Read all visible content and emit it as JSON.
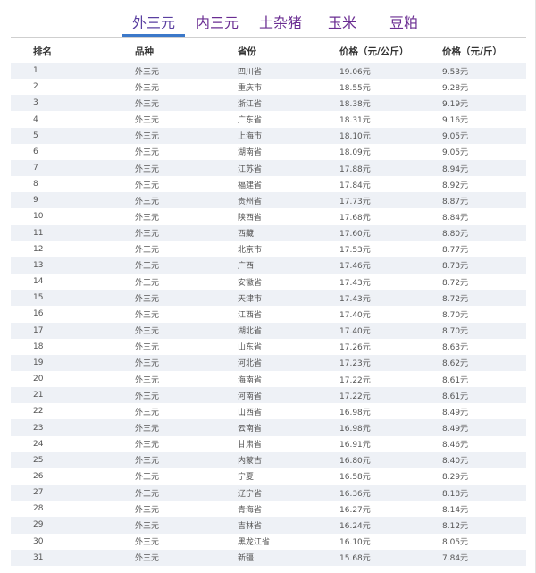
{
  "tabs": [
    {
      "label": "外三元",
      "active": true
    },
    {
      "label": "内三元",
      "active": false
    },
    {
      "label": "土杂猪",
      "active": false
    },
    {
      "label": "玉米",
      "active": false
    },
    {
      "label": "豆粕",
      "active": false
    }
  ],
  "table": {
    "headers": [
      "排名",
      "品种",
      "省份",
      "价格（元/公斤）",
      "价格（元/斤）"
    ],
    "rows": [
      [
        "1",
        "外三元",
        "四川省",
        "19.06元",
        "9.53元"
      ],
      [
        "2",
        "外三元",
        "重庆市",
        "18.55元",
        "9.28元"
      ],
      [
        "3",
        "外三元",
        "浙江省",
        "18.38元",
        "9.19元"
      ],
      [
        "4",
        "外三元",
        "广东省",
        "18.31元",
        "9.16元"
      ],
      [
        "5",
        "外三元",
        "上海市",
        "18.10元",
        "9.05元"
      ],
      [
        "6",
        "外三元",
        "湖南省",
        "18.09元",
        "9.05元"
      ],
      [
        "7",
        "外三元",
        "江苏省",
        "17.88元",
        "8.94元"
      ],
      [
        "8",
        "外三元",
        "福建省",
        "17.84元",
        "8.92元"
      ],
      [
        "9",
        "外三元",
        "贵州省",
        "17.73元",
        "8.87元"
      ],
      [
        "10",
        "外三元",
        "陕西省",
        "17.68元",
        "8.84元"
      ],
      [
        "11",
        "外三元",
        "西藏",
        "17.60元",
        "8.80元"
      ],
      [
        "12",
        "外三元",
        "北京市",
        "17.53元",
        "8.77元"
      ],
      [
        "13",
        "外三元",
        "广西",
        "17.46元",
        "8.73元"
      ],
      [
        "14",
        "外三元",
        "安徽省",
        "17.43元",
        "8.72元"
      ],
      [
        "15",
        "外三元",
        "天津市",
        "17.43元",
        "8.72元"
      ],
      [
        "16",
        "外三元",
        "江西省",
        "17.40元",
        "8.70元"
      ],
      [
        "17",
        "外三元",
        "湖北省",
        "17.40元",
        "8.70元"
      ],
      [
        "18",
        "外三元",
        "山东省",
        "17.26元",
        "8.63元"
      ],
      [
        "19",
        "外三元",
        "河北省",
        "17.23元",
        "8.62元"
      ],
      [
        "20",
        "外三元",
        "海南省",
        "17.22元",
        "8.61元"
      ],
      [
        "21",
        "外三元",
        "河南省",
        "17.22元",
        "8.61元"
      ],
      [
        "22",
        "外三元",
        "山西省",
        "16.98元",
        "8.49元"
      ],
      [
        "23",
        "外三元",
        "云南省",
        "16.98元",
        "8.49元"
      ],
      [
        "24",
        "外三元",
        "甘肃省",
        "16.91元",
        "8.46元"
      ],
      [
        "25",
        "外三元",
        "内蒙古",
        "16.80元",
        "8.40元"
      ],
      [
        "26",
        "外三元",
        "宁夏",
        "16.58元",
        "8.29元"
      ],
      [
        "27",
        "外三元",
        "辽宁省",
        "16.36元",
        "8.18元"
      ],
      [
        "28",
        "外三元",
        "青海省",
        "16.27元",
        "8.14元"
      ],
      [
        "29",
        "外三元",
        "吉林省",
        "16.24元",
        "8.12元"
      ],
      [
        "30",
        "外三元",
        "黑龙江省",
        "16.10元",
        "8.05元"
      ],
      [
        "31",
        "外三元",
        "新疆",
        "15.68元",
        "7.84元"
      ]
    ]
  }
}
